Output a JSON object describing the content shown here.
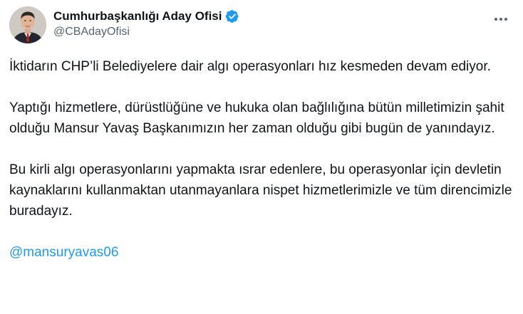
{
  "account": {
    "display_name": "Cumhurbaşkanlığı Aday Ofisi",
    "handle": "@CBAdayOfisi",
    "verified": true
  },
  "tweet": {
    "paragraphs": [
      "İktidarın CHP’li Belediyelere dair algı operasyonları hız kesmeden devam ediyor.",
      "Yaptığı hizmetlere, dürüstlüğüne ve hukuka olan bağlılığına bütün milletimizin şahit olduğu Mansur Yavaş Başkanımızın her zaman olduğu gibi bugün de yanındayız.",
      "Bu kirli algı operasyonlarını yapmakta ısrar edenlere, bu operasyonlar için devletin kaynaklarını kullanmaktan utanmayanlara nispet hizmetlerimizle ve tüm direncimizle buradayız."
    ],
    "mention": "@mansuryavas06"
  },
  "icons": {
    "verified": "verified-badge-icon",
    "more": "more-options-icon"
  },
  "colors": {
    "text": "#0f1419",
    "secondary": "#536471",
    "accent": "#1d9bf0"
  }
}
